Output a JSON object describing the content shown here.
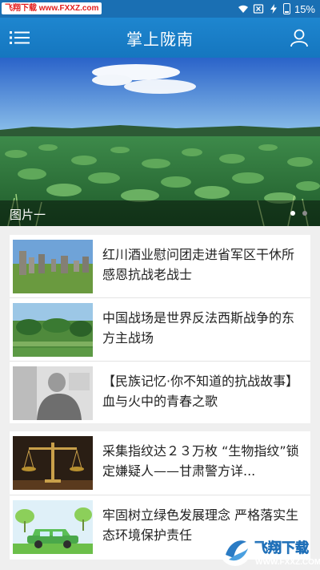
{
  "status_bar": {
    "watermark": "飞翔下载 www.FXXZ.com",
    "battery": "15%"
  },
  "header": {
    "title": "掌上陇南"
  },
  "banner": {
    "caption": "图片一",
    "dots_total": 2,
    "dots_active": 1
  },
  "news": [
    {
      "title": "红川酒业慰问团走进省军区干休所感恩抗战老战士",
      "thumb": "stone-forest-photo"
    },
    {
      "title": "中国战场是世界反法西斯战争的东方主战场",
      "thumb": "green-landscape-photo"
    },
    {
      "title": "【民族记忆·你不知道的抗战故事】血与火中的青春之歌",
      "thumb": "old-portrait-photo"
    },
    {
      "title": "采集指纹达２３万枚 “生物指纹”锁定嫌疑人——甘肃警方详...",
      "thumb": "scales-of-justice-photo"
    },
    {
      "title": "牢固树立绿色发展理念 严格落实生态环境保护责任",
      "thumb": "green-car-illustration"
    }
  ],
  "watermark_bottom": {
    "name": "飞翔下载",
    "url": "WWW.FXXZ.COM"
  }
}
